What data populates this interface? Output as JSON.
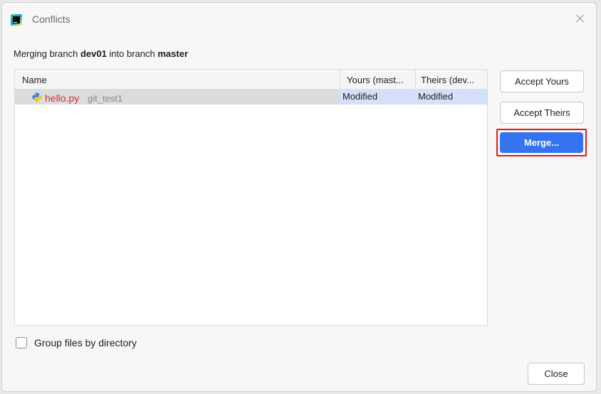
{
  "window": {
    "title": "Conflicts"
  },
  "message": {
    "prefix": "Merging branch ",
    "source_branch": "dev01",
    "middle": " into branch ",
    "target_branch": "master"
  },
  "table": {
    "columns": [
      "Name",
      "Yours (mast...",
      "Theirs (dev..."
    ],
    "rows": [
      {
        "file": "hello.py",
        "module": "git_test1",
        "yours": "Modified",
        "theirs": "Modified",
        "selected": true
      }
    ]
  },
  "buttons": {
    "accept_yours": "Accept Yours",
    "accept_theirs": "Accept Theirs",
    "merge": "Merge...",
    "close": "Close"
  },
  "options": {
    "group_by_directory_label": "Group files by directory",
    "group_by_directory_checked": false
  },
  "colors": {
    "accent": "#3574f0",
    "highlight_border": "#e01b1b",
    "conflict_file": "#db2b2b"
  },
  "icons": {
    "app": "pycharm-icon",
    "file": "python-file-icon",
    "close": "close-icon"
  }
}
